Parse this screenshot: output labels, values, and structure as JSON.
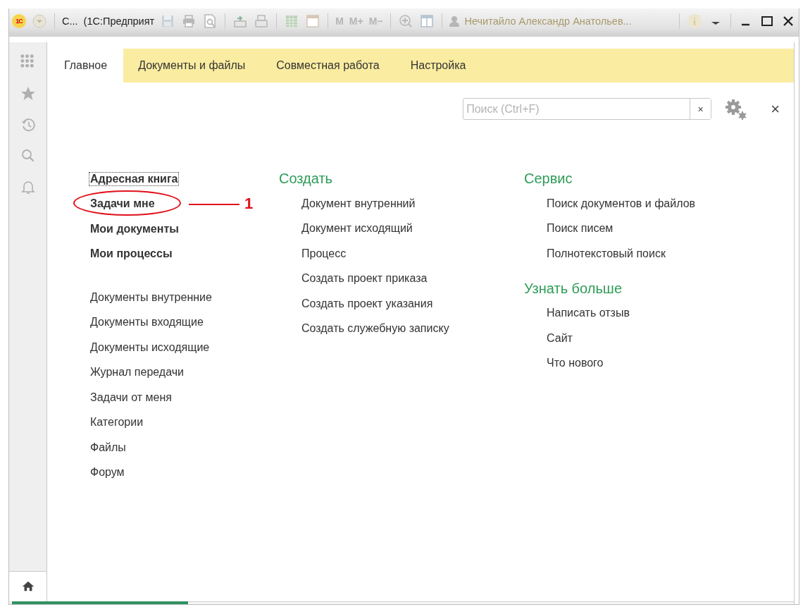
{
  "title_bar": {
    "logo": "1С",
    "title": "С...",
    "app_name": "(1С:Предприят",
    "memory_buttons": [
      "M",
      "M+",
      "M−"
    ],
    "user": "Нечитайло Александр Анатольев..."
  },
  "tabs": [
    {
      "label": "Главное",
      "selected": true
    },
    {
      "label": "Документы и файлы",
      "selected": false
    },
    {
      "label": "Совместная работа",
      "selected": false
    },
    {
      "label": "Настройка",
      "selected": false
    }
  ],
  "search": {
    "placeholder": "Поиск (Ctrl+F)",
    "clear": "×"
  },
  "close": "×",
  "main_links": [
    {
      "text": "Адресная книга",
      "focused": true
    },
    {
      "text": "Задачи мне",
      "focused": false,
      "annotation": "1"
    },
    {
      "text": "Мои документы",
      "focused": false
    },
    {
      "text": "Мои процессы",
      "focused": false
    }
  ],
  "other_links": [
    "Документы внутренние",
    "Документы входящие",
    "Документы исходящие",
    "Журнал передачи",
    "Задачи от меня",
    "Категории",
    "Файлы",
    "Форум"
  ],
  "columns": [
    {
      "sections": [
        {
          "heading": "Создать",
          "items": [
            "Документ внутренний",
            "Документ исходящий",
            "Процесс",
            "Создать проект приказа",
            "Создать проект указания",
            "Создать служебную записку"
          ]
        }
      ]
    },
    {
      "sections": [
        {
          "heading": "Сервис",
          "items": [
            "Поиск документов и файлов",
            "Поиск писем",
            "Полнотекстовый поиск"
          ]
        },
        {
          "heading": "Узнать больше",
          "items": [
            "Написать отзыв",
            "Сайт",
            "Что нового"
          ]
        }
      ]
    }
  ]
}
